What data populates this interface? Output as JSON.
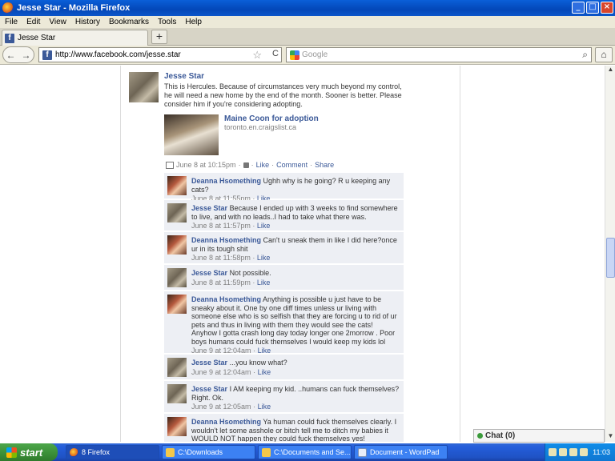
{
  "window": {
    "title": "Jesse Star - Mozilla Firefox",
    "buttons": {
      "minimize": "_",
      "maximize": "□",
      "close": "×"
    }
  },
  "menu": [
    "File",
    "Edit",
    "View",
    "History",
    "Bookmarks",
    "Tools",
    "Help"
  ],
  "tab": {
    "label": "Jesse Star",
    "new_tab": "+"
  },
  "nav": {
    "back": "←",
    "forward": "→",
    "url": "http://www.facebook.com/jesse.star",
    "star": "☆",
    "reload": "C",
    "search_placeholder": "Google",
    "search_icon": "⌕",
    "home": "⌂"
  },
  "post": {
    "author": "Jesse Star",
    "text": "This is Hercules. Because of circumstances very much beyond my control, he will need a new home by the end of the month. Sooner is better. Please consider him if you're considering adopting.",
    "share_title": "Maine Coon for adoption",
    "share_source": "toronto.en.craigslist.ca",
    "meta_date": "June 8 at 10:15pm",
    "meta_like": "Like",
    "meta_comment": "Comment",
    "meta_share": "Share",
    "sep": "·"
  },
  "comments": [
    {
      "author": "Deanna Hsomething",
      "text": "Ughh why is he going? R u keeping any cats?",
      "time": "June 8 at 11:55pm",
      "like": "Like",
      "avatar": "deanna"
    },
    {
      "author": "Jesse Star",
      "text": "Because I ended up with 3 weeks to find somewhere to live, and with no leads..I had to take what there was.",
      "time": "June 8 at 11:57pm",
      "like": "Like",
      "avatar": "jesse"
    },
    {
      "author": "Deanna Hsomething",
      "text": "Can't u sneak them in like I did here?once ur in its tough shit",
      "time": "June 8 at 11:58pm",
      "like": "Like",
      "avatar": "deanna"
    },
    {
      "author": "Jesse Star",
      "text": "Not possible.",
      "time": "June 8 at 11:59pm",
      "like": "Like",
      "avatar": "jesse"
    },
    {
      "author": "Deanna Hsomething",
      "text": "Anything is possible u just have to be sneaky about it. One by one diff times unless ur living with someone else who is so selfish that they are forcing u to rid of ur pets and thus in living with them they would see the cats! Anyhow I gotta crash long day today longer one 2morrow . Poor boys humans could fuck themselves I would keep my kids lol",
      "time": "June 9 at 12:04am",
      "like": "Like",
      "avatar": "deanna"
    },
    {
      "author": "Jesse Star",
      "text": "...you know what?",
      "time": "June 9 at 12:04am",
      "like": "Like",
      "avatar": "jesse"
    },
    {
      "author": "Jesse Star",
      "text": "I AM keeping my kid. ..humans can fuck themselves? Right. Ok.",
      "time": "June 9 at 12:05am",
      "like": "Like",
      "avatar": "jesse"
    },
    {
      "author": "Deanna Hsomething",
      "text": "Ya human could fuck themselves clearly. I wouldn't let some asshole or bitch tell me to ditch my babies it WOULD NOT happen they could fuck themselves yes!",
      "time": "",
      "like": "",
      "avatar": "deanna"
    }
  ],
  "chat": {
    "label": "Chat (0)"
  },
  "taskbar": {
    "start": "start",
    "tasks": [
      "8 Firefox",
      "C:\\Downloads",
      "C:\\Documents and Se...",
      "Document - WordPad"
    ],
    "clock": "11:03"
  }
}
